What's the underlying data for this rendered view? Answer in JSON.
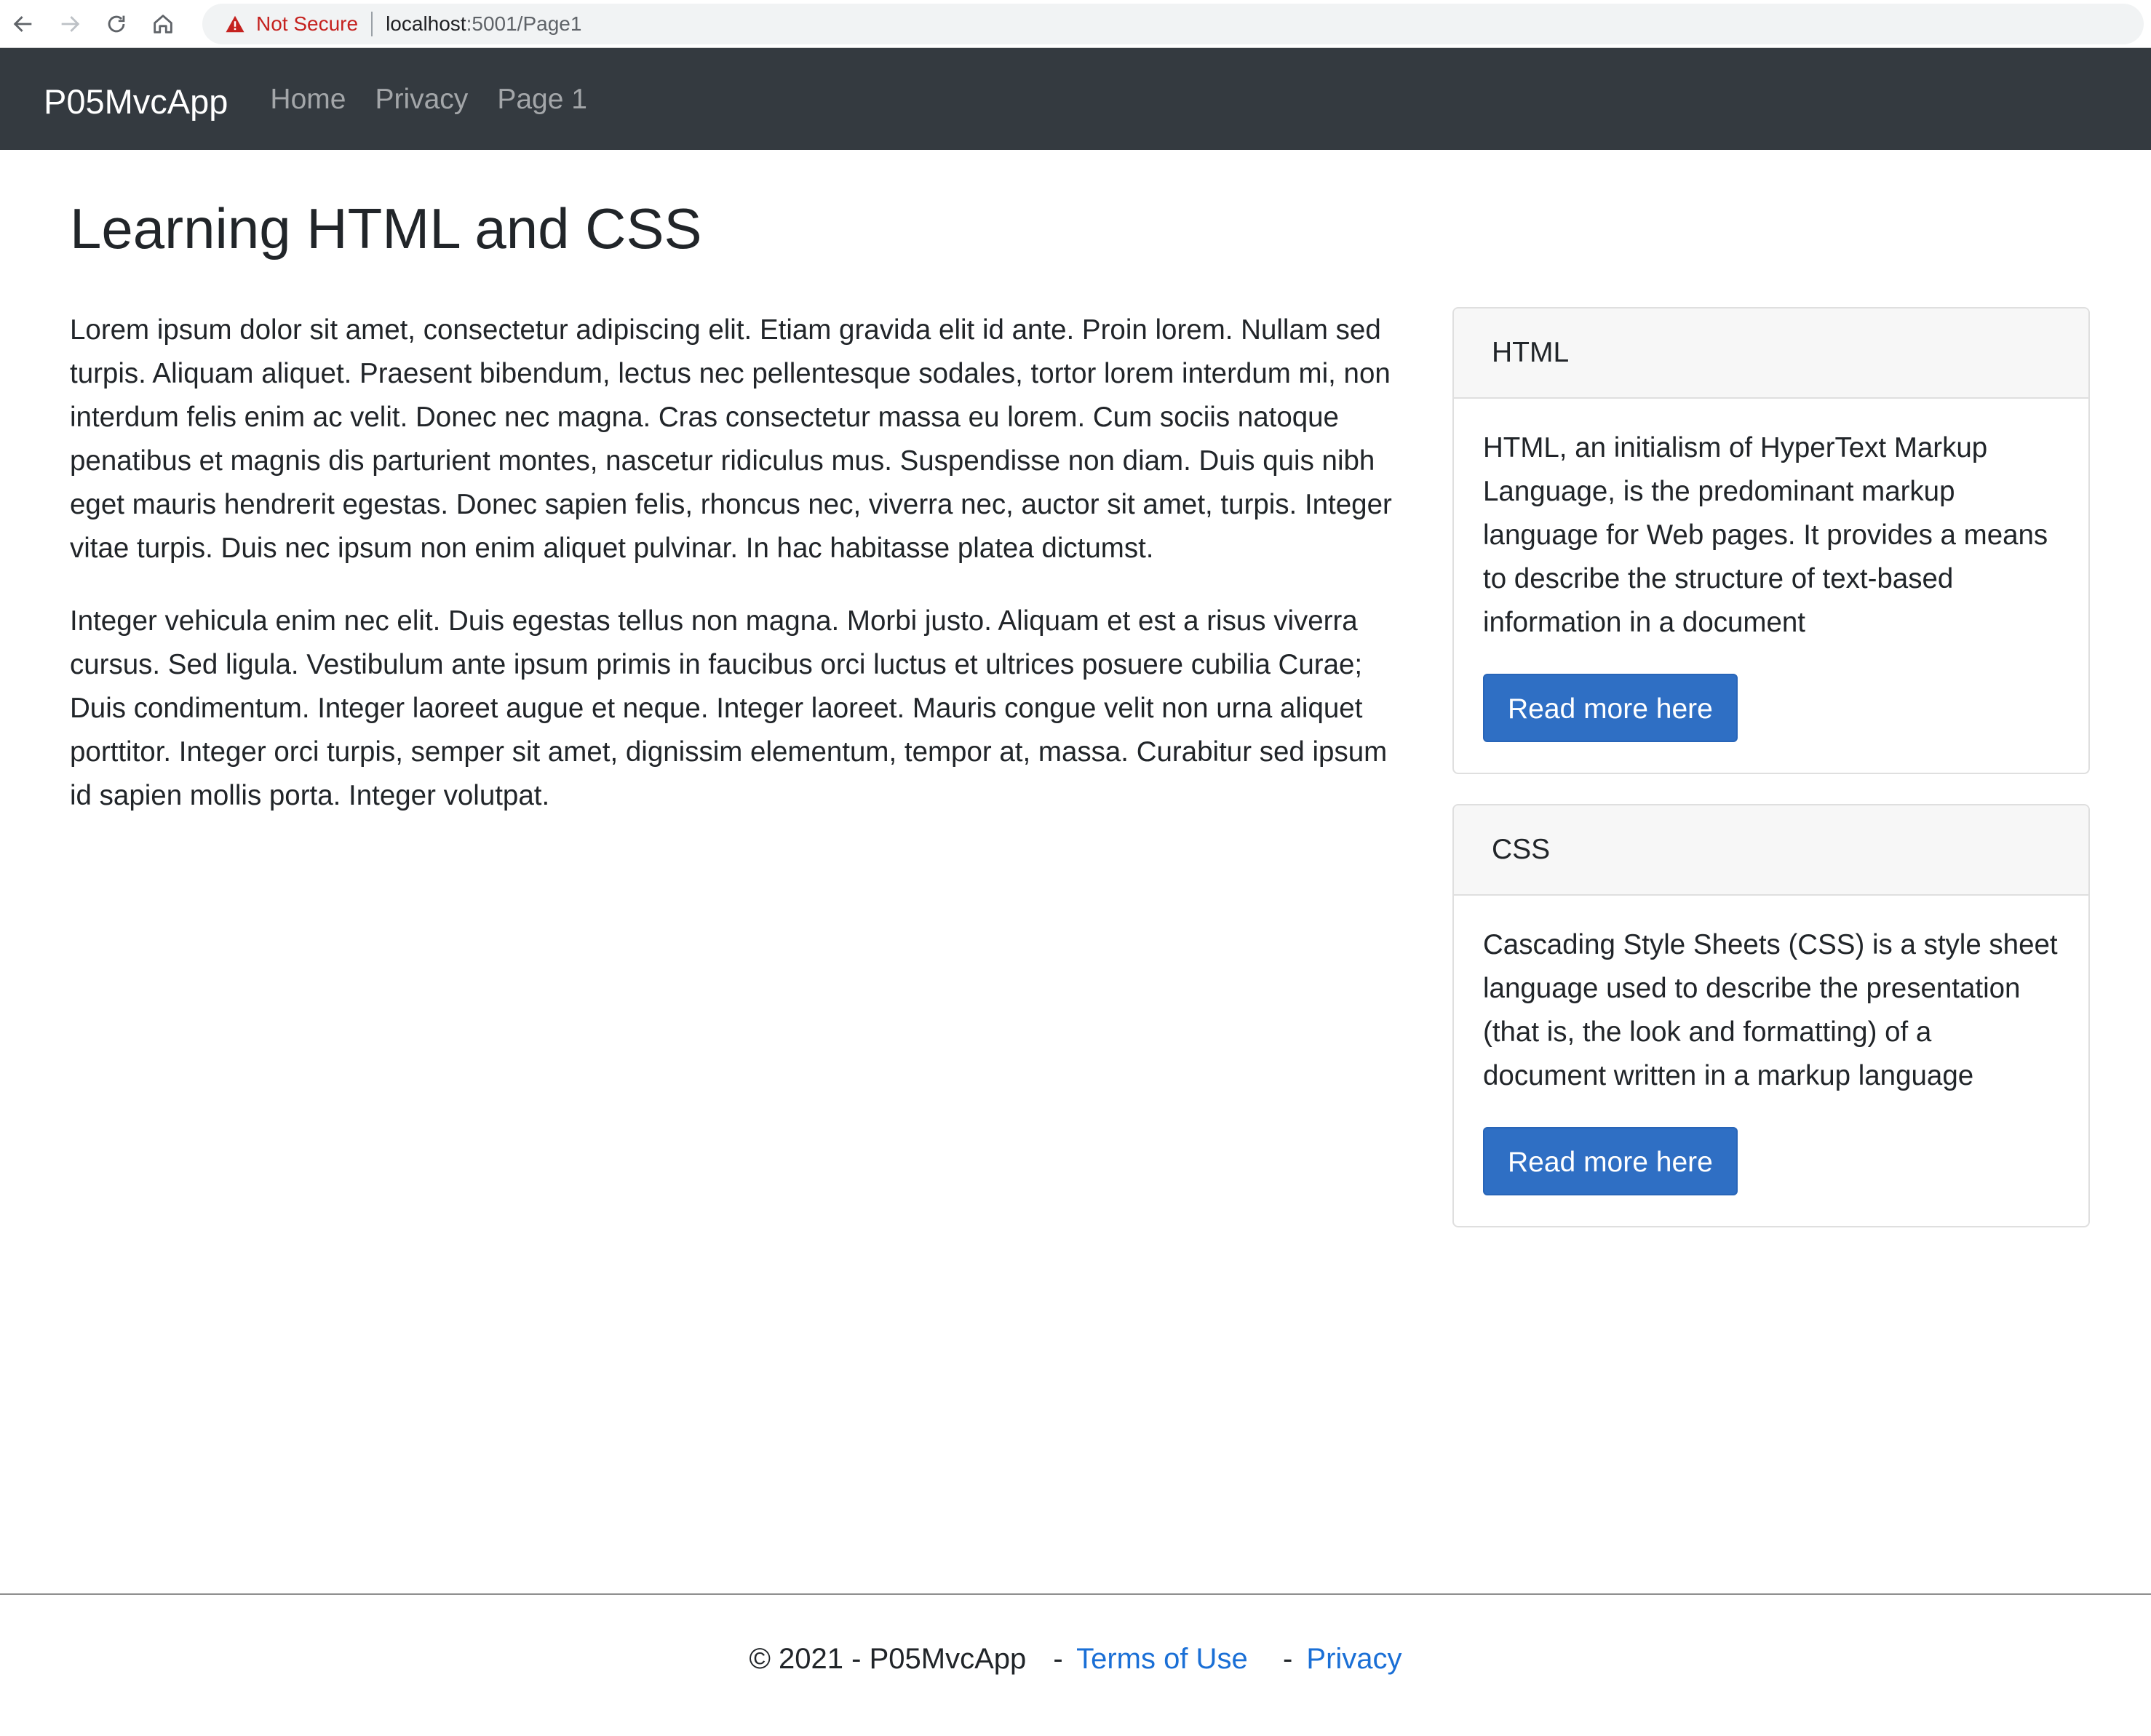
{
  "browser": {
    "security_label": "Not Secure",
    "url_host": "localhost",
    "url_path": ":5001/Page1"
  },
  "navbar": {
    "brand": "P05MvcApp",
    "links": [
      "Home",
      "Privacy",
      "Page 1"
    ]
  },
  "main": {
    "title": "Learning HTML and CSS",
    "paragraphs": [
      "Lorem ipsum dolor sit amet, consectetur adipiscing elit. Etiam gravida elit id ante. Proin lorem. Nullam sed turpis. Aliquam aliquet. Praesent bibendum, lectus nec pellentesque sodales, tortor lorem interdum mi, non interdum felis enim ac velit. Donec nec magna. Cras consectetur massa eu lorem. Cum sociis natoque penatibus et magnis dis parturient montes, nascetur ridiculus mus. Suspendisse non diam. Duis quis nibh eget mauris hendrerit egestas. Donec sapien felis, rhoncus nec, viverra nec, auctor sit amet, turpis. Integer vitae turpis. Duis nec ipsum non enim aliquet pulvinar. In hac habitasse platea dictumst.",
      "Integer vehicula enim nec elit. Duis egestas tellus non magna. Morbi justo. Aliquam et est a risus viverra cursus. Sed ligula. Vestibulum ante ipsum primis in faucibus orci luctus et ultrices posuere cubilia Curae; Duis condimentum. Integer laoreet augue et neque. Integer laoreet. Mauris congue velit non urna aliquet porttitor. Integer orci turpis, semper sit amet, dignissim elementum, tempor at, massa. Curabitur sed ipsum id sapien mollis porta. Integer volutpat."
    ]
  },
  "cards": [
    {
      "header": "HTML",
      "text": "HTML, an initialism of HyperText Markup Language, is the predominant markup language for Web pages. It provides a means to describe the structure of text-based information in a document",
      "button": "Read more here"
    },
    {
      "header": "CSS",
      "text": "Cascading Style Sheets (CSS) is a style sheet language used to describe the presentation (that is, the look and formatting) of a document written in a markup language",
      "button": "Read more here"
    }
  ],
  "footer": {
    "copyright": "© 2021 - P05MvcApp",
    "separator": "-",
    "terms_link": "Terms of Use",
    "privacy_link": "Privacy"
  },
  "colors": {
    "navbar_bg": "#343a40",
    "primary_button": "#2f6fc4",
    "link": "#1a6fd6",
    "warning": "#c5221f"
  }
}
